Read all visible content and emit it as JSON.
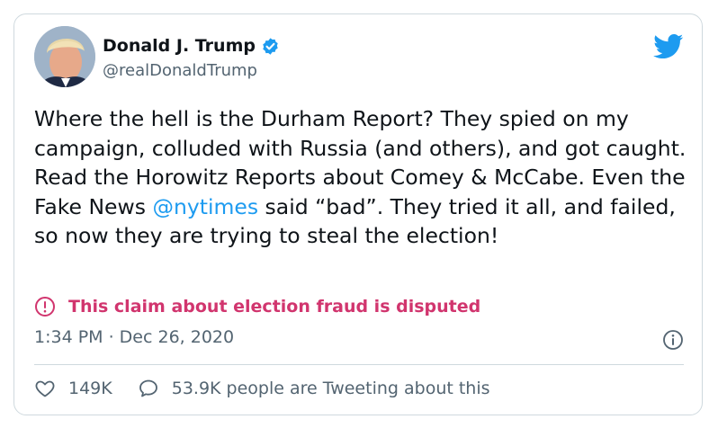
{
  "author": {
    "display_name": "Donald J. Trump",
    "handle": "@realDonaldTrump",
    "verified": true
  },
  "tweet": {
    "text_before_mention": "Where the hell is the Durham Report? They spied on my campaign, colluded with Russia (and others), and got caught. Read the Horowitz Reports about Comey & McCabe. Even the Fake News ",
    "mention": "@nytimes",
    "text_after_mention": " said “bad”. They tried it all, and failed, so now they are trying to steal the election!"
  },
  "label": {
    "text": "This claim about election fraud is disputed",
    "color": "#d1356e",
    "icon": "exclamation-circle-icon"
  },
  "timestamp": "1:34 PM · Dec 26, 2020",
  "engagement": {
    "likes": "149K",
    "replies_text": "53.9K people are Tweeting about this"
  },
  "colors": {
    "accent": "#1d9bf0",
    "text": "#0f1419",
    "muted": "#536471",
    "border": "#cfd9de"
  },
  "icons": {
    "brand": "twitter-bird-icon",
    "verified": "verified-badge-icon",
    "info": "info-icon",
    "like": "heart-icon",
    "reply": "speech-bubble-icon"
  }
}
